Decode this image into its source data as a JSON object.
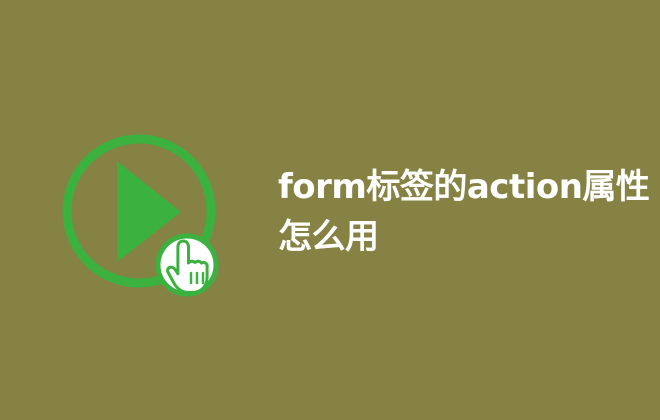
{
  "page": {
    "background_color": "#868244"
  },
  "graphic": {
    "icon": "play-video-icon",
    "overlay_icon": "pointing-hand-cursor-icon",
    "ring_color": "#3bb13f",
    "triangle_color": "#3bb13f",
    "hand_fill": "#ffffff",
    "hand_outline": "#3bb13f"
  },
  "title": {
    "text": "form标签的action属性怎么用",
    "color": "#ffffff"
  }
}
